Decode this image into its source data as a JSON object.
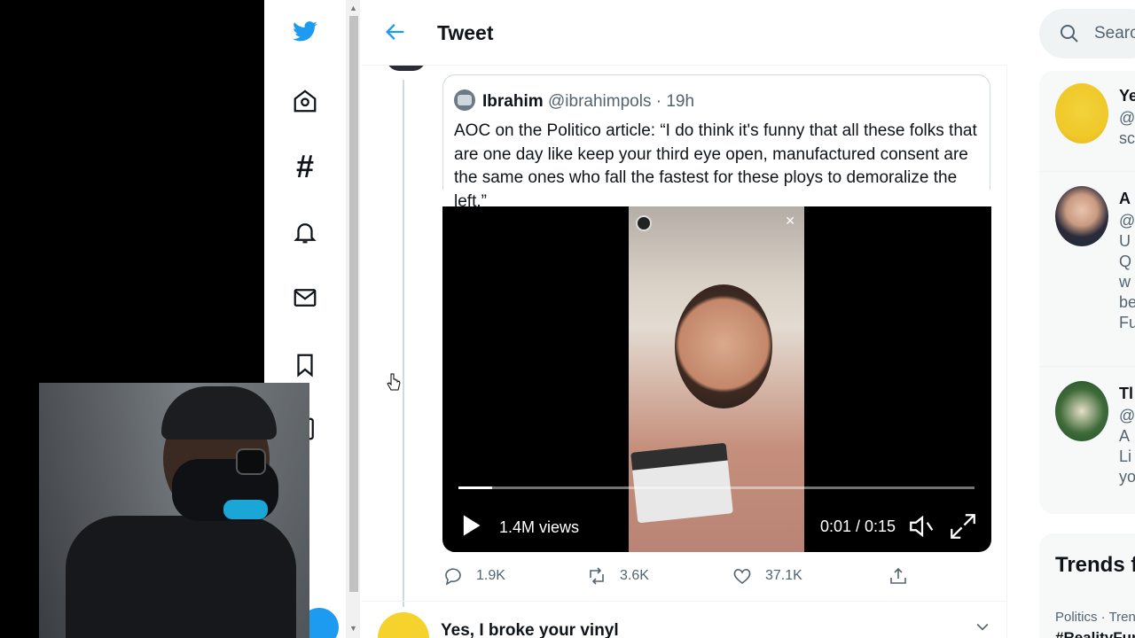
{
  "header": {
    "title": "Tweet"
  },
  "quote": {
    "name": "Ibrahim",
    "handle": "@ibrahimpols · 19h",
    "text": "AOC on the Politico article: “I do think it's funny that all these folks that are one day like keep your third eye open, manufactured consent are the same ones who fall the fastest for these ploys to demoralize the left.”"
  },
  "video": {
    "views": "1.4M views",
    "time": "0:01 / 0:15",
    "progress": 0.065
  },
  "actions": {
    "replies": "1.9K",
    "retweets": "3.6K",
    "likes": "37.1K"
  },
  "next_tweet": {
    "name": "Yes, I broke your vinyl"
  },
  "search": {
    "placeholder": "Search Twitter"
  },
  "who_to_follow": [
    {
      "name": "Ye",
      "text": "@\nsc"
    },
    {
      "name": "A",
      "text": "@\nU\nQ\nw\nbe\nFu"
    },
    {
      "name": "Tl",
      "text": "@\nA\nLi\nyo"
    }
  ],
  "trends": {
    "title": "Trends for you",
    "category": "Politics · Trending",
    "tag": "#RealityFunds"
  },
  "colors": {
    "accent": "#1d9bf0",
    "text": "#0f1419",
    "muted": "#536471"
  }
}
